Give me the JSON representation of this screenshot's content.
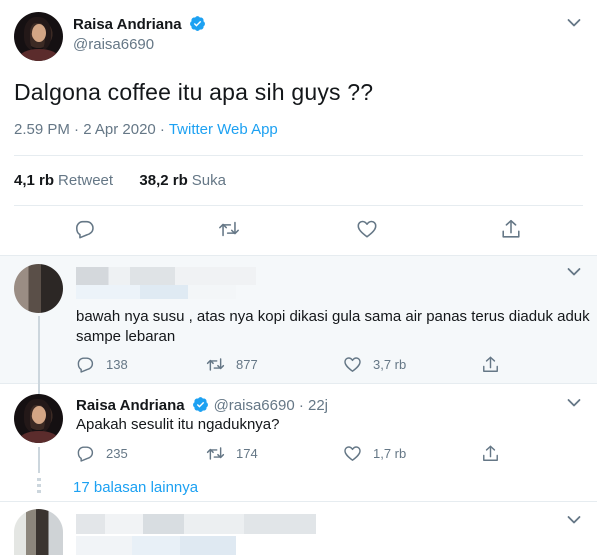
{
  "main_tweet": {
    "display_name": "Raisa Andriana",
    "handle": "@raisa6690",
    "text": "Dalgona coffee itu apa sih guys ??",
    "time": "2.59 PM · 2 Apr 2020 · ",
    "app": "Twitter Web App",
    "retweets_count": "4,1 rb",
    "retweets_label": "Retweet",
    "likes_count": "38,2 rb",
    "likes_label": "Suka"
  },
  "replies": [
    {
      "text_line1": "bawah nya susu , atas nya kopi dikasi gula sama air panas terus diaduk aduk",
      "text_line2": "sampe lebaran",
      "reply_count": "138",
      "retweet_count": "877",
      "like_count": "3,7 rb"
    },
    {
      "display_name": "Raisa Andriana",
      "handle": "@raisa6690 · 22j",
      "text": "Apakah sesulit itu ngaduknya?",
      "reply_count": "235",
      "retweet_count": "174",
      "like_count": "1,7 rb"
    }
  ],
  "more_replies": "17 balasan lainnya",
  "colors": {
    "accent": "#1da1f2",
    "secondary_text": "#657786",
    "highlight_bg": "#f5f8fa"
  },
  "icons": [
    "verified-badge-icon",
    "chevron-down-icon",
    "reply-icon",
    "retweet-icon",
    "like-icon",
    "share-icon"
  ]
}
